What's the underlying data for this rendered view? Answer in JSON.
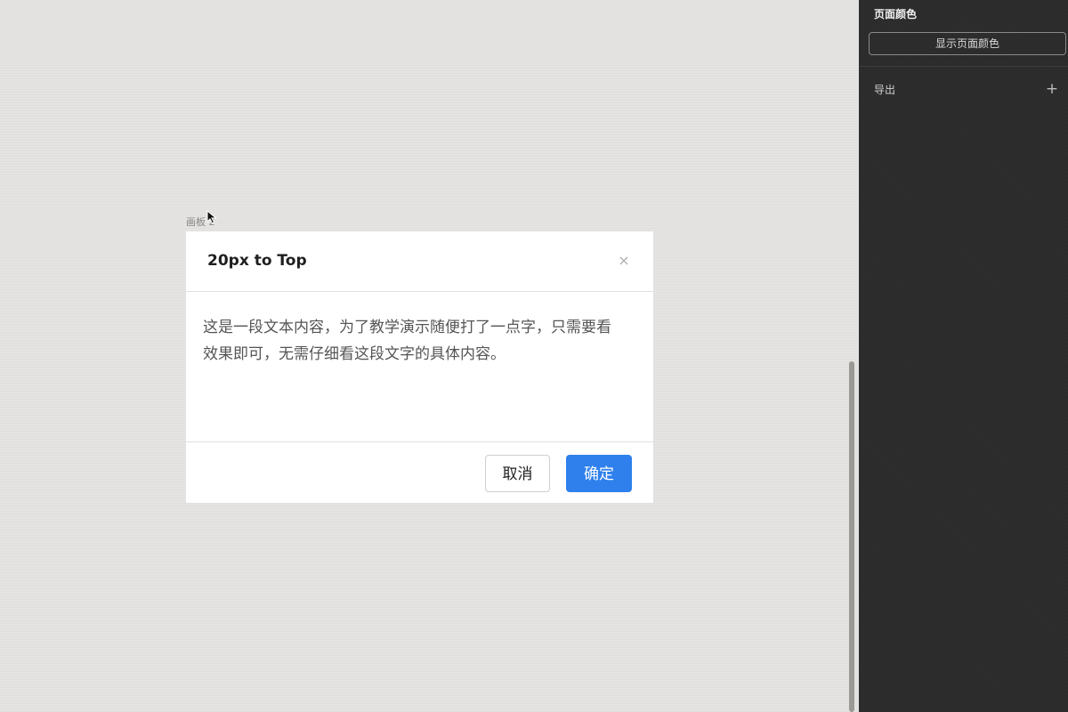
{
  "canvas": {
    "artboard_label": "画板 2"
  },
  "dialog": {
    "title": "20px to Top",
    "close_glyph": "×",
    "body_line1": "这是一段文本内容，为了教学演示随便打了一点字，只需要看",
    "body_line2": "效果即可，无需仔细看这段文字的具体内容。",
    "cancel_label": "取消",
    "ok_label": "确定"
  },
  "panel": {
    "page_color_heading": "页面颜色",
    "show_page_color_label": "显示页面颜色",
    "export_heading": "导出",
    "export_add_glyph": "+"
  },
  "icons": {
    "cursor": "arrow-cursor-icon",
    "close": "close-icon",
    "add": "plus-icon"
  },
  "colors": {
    "primary": "#2f80ed",
    "canvas_bg": "#e4e3e1",
    "panel_bg": "#2b2b2b"
  }
}
